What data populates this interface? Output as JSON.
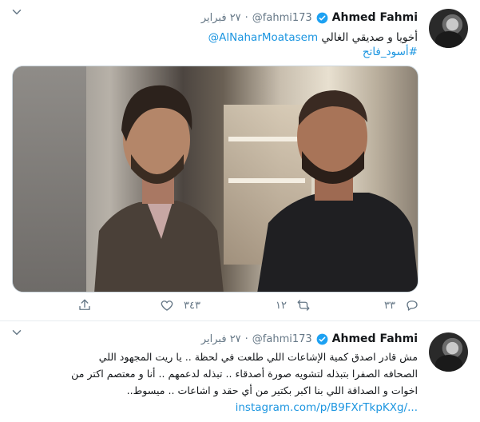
{
  "tweets": [
    {
      "author_name": "Ahmed Fahmi",
      "handle": "@fahmi173",
      "date": "٢٧ فبراير",
      "text_line1": "أخويا و صديقي الغالي",
      "mention": "@AlNaharMoatasem",
      "hashtag": "#أسود_فاتح",
      "replies": "٣٣",
      "retweets": "١٢",
      "likes": "٣٤٣"
    },
    {
      "author_name": "Ahmed Fahmi",
      "handle": "@fahmi173",
      "date": "٢٧ فبراير",
      "lines": [
        "مش قادر اصدق كمية الإشاعات اللي طلعت في لحظة .. يا ريت المجهود اللي",
        "الصحافه الصفرا بتبذله لتشويه صورة أصدقاء .. تبذله لدعمهم .. أنا و معتصم اكتر من",
        "اخوات و الصداقة اللي بنا اكبر بكتير من أي حقد و اشاعات .. ميسوط.."
      ],
      "link": "instagram.com/p/B9FXrTkpKXg/..."
    }
  ],
  "colors": {
    "link": "#1b95e0",
    "secondary_text": "#657786",
    "verified": "#1da1f2"
  }
}
